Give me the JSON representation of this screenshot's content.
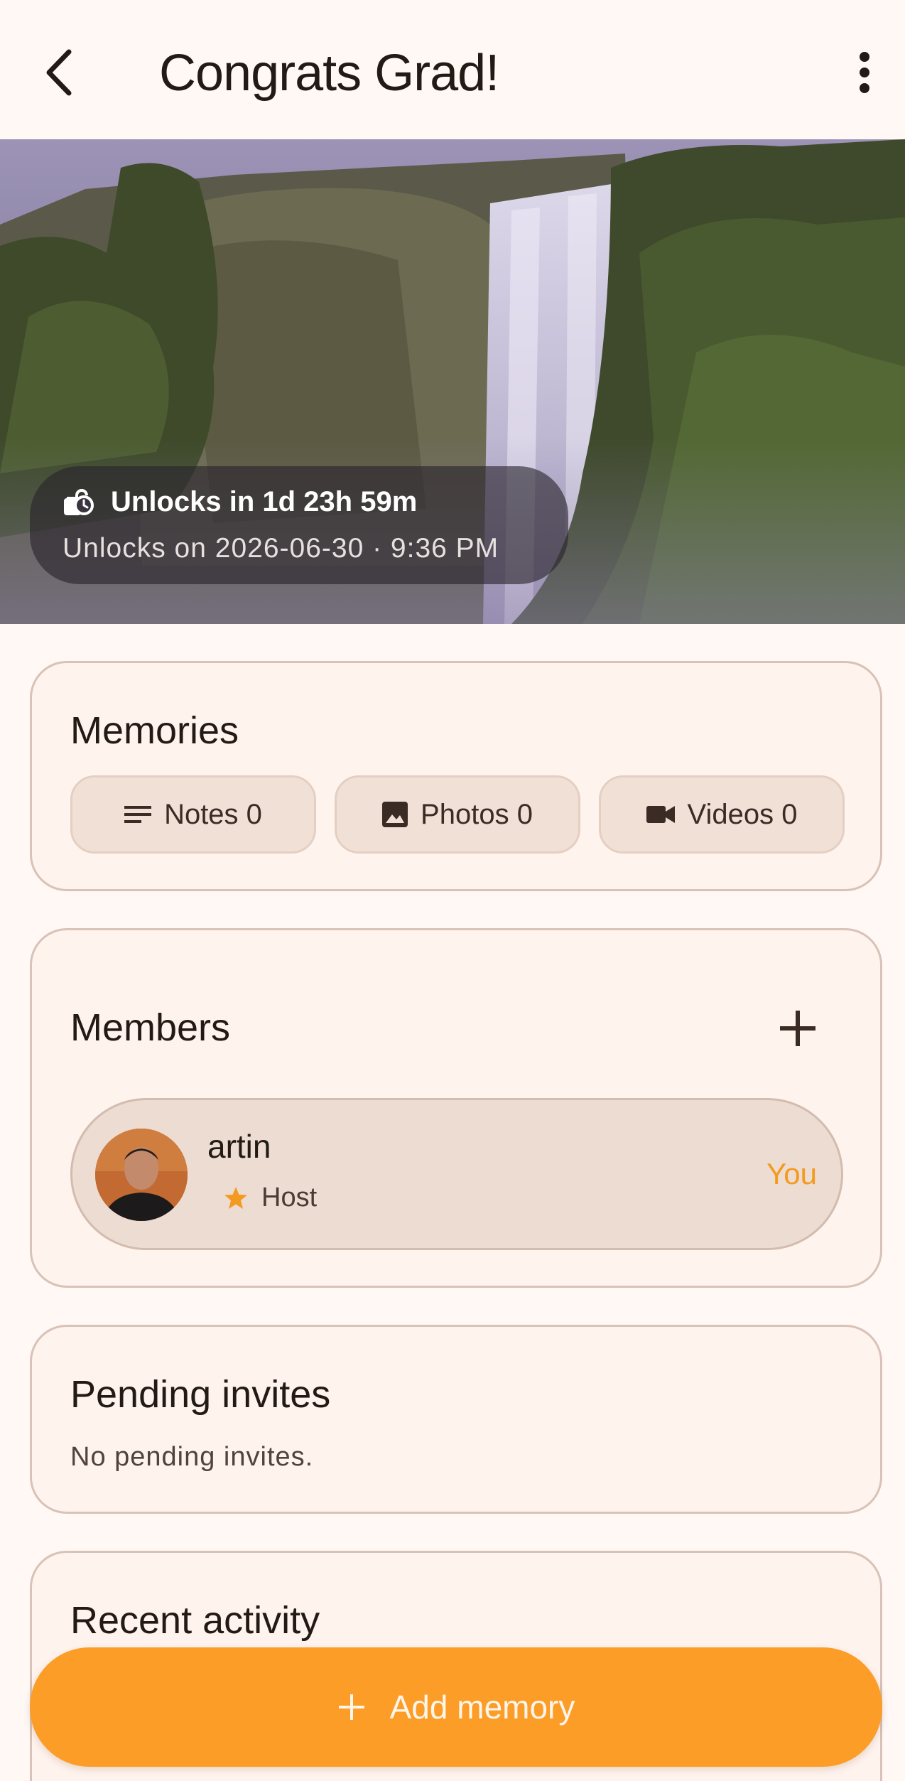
{
  "app_bar": {
    "title": "Congrats Grad!",
    "back_icon": "arrow-back-icon",
    "menu_icon": "more-vert-icon"
  },
  "hero": {
    "image_subject": "waterfall landscape",
    "unlock_countdown": "Unlocks in 1d 23h 59m",
    "unlock_date": "Unlocks on 2026-06-30 · 9:36 PM",
    "icon": "timer-lock-icon"
  },
  "memories": {
    "title": "Memories",
    "chips": [
      {
        "label": "Notes 0",
        "icon": "notes-icon"
      },
      {
        "label": "Photos 0",
        "icon": "image-icon"
      },
      {
        "label": "Videos 0",
        "icon": "videocam-icon"
      }
    ]
  },
  "members": {
    "title": "Members",
    "add_icon": "add-icon",
    "list": [
      {
        "name": "artin",
        "role": "Host",
        "badge": "You",
        "role_icon": "star-icon"
      }
    ]
  },
  "pending": {
    "title": "Pending invites",
    "empty_text": "No pending invites."
  },
  "recent": {
    "title": "Recent activity"
  },
  "fab": {
    "label": "Add memory",
    "icon": "add-icon"
  },
  "colors": {
    "background": "#fff8f5",
    "card": "#fff3ee",
    "card_border": "#d9c2b7",
    "chip": "#f1e0d6",
    "accent": "#fb9d27",
    "you_badge": "#f39a21",
    "star": "#f39a21"
  }
}
